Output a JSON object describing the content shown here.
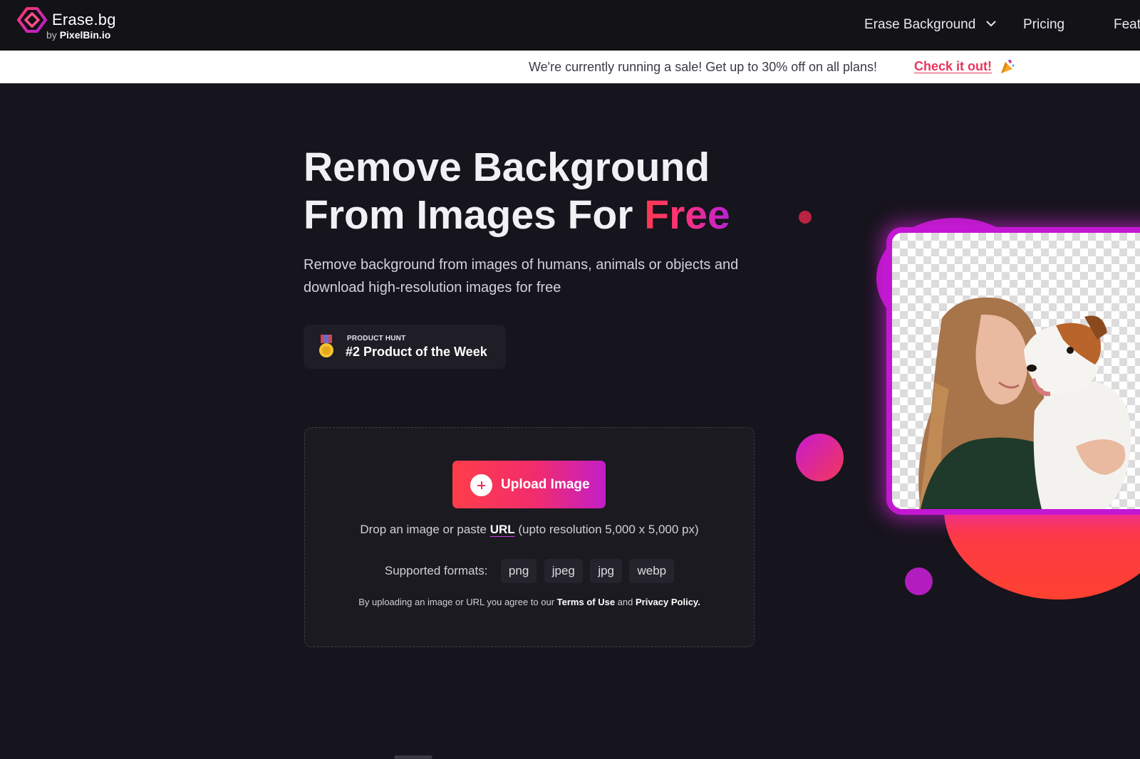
{
  "brand": {
    "name": "Erase.bg",
    "sub_prefix": "by",
    "sub_name": "PixelBin.io",
    "colors": {
      "accent_red": "#ff3a4f",
      "accent_pink": "#f12c6e",
      "accent_purple": "#c21ec9"
    }
  },
  "nav": {
    "dropdown_label": "Erase Background",
    "pricing_label": "Pricing",
    "features_label": "Feat"
  },
  "banner": {
    "text": "We're currently running a sale! Get up to 30% off on all plans!",
    "link_label": "Check it out!",
    "emoji": "party-popper-icon"
  },
  "hero": {
    "title_line1": "Remove Background",
    "title_line2_prefix": "From Images For ",
    "title_highlight": "Free",
    "subtitle": "Remove background from images of humans, animals or objects and download high-resolution images for free"
  },
  "badge": {
    "small": "PRODUCT HUNT",
    "big": "#2 Product of the Week",
    "icon": "medal-icon"
  },
  "upload": {
    "button_label": "Upload Image",
    "drop_prefix": "Drop an image or paste ",
    "drop_link": "URL",
    "drop_suffix": " (upto resolution 5,000 x 5,000 px)",
    "formats_label": "Supported formats:",
    "formats": [
      "png",
      "jpeg",
      "jpg",
      "webp"
    ],
    "terms_prefix": "By uploading an image or URL you agree to our ",
    "terms_link": "Terms of Use",
    "terms_and": " and ",
    "privacy_link": "Privacy Policy."
  }
}
